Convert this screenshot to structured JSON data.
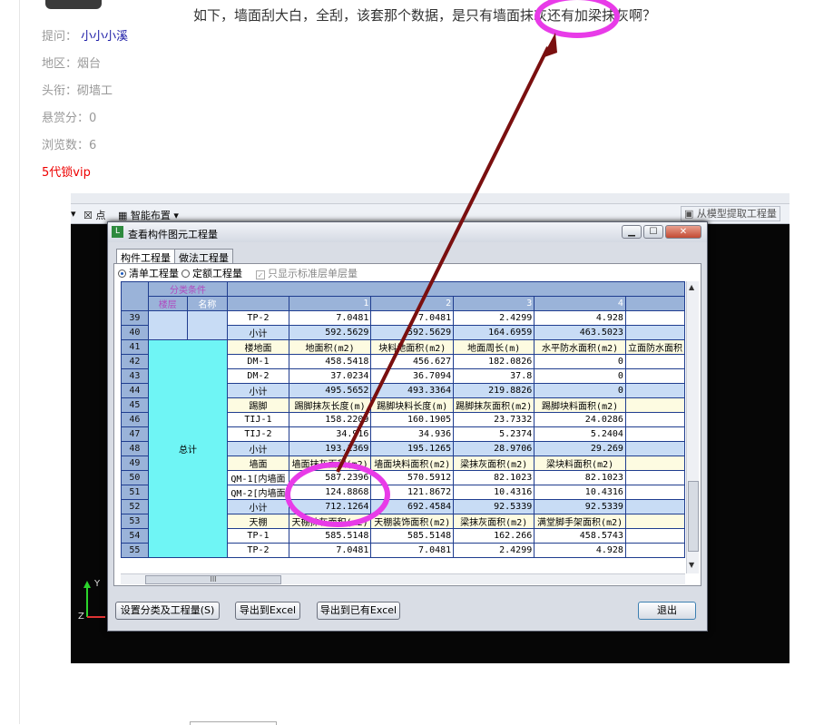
{
  "post": {
    "question": "如下，墙面刮大白，全刮，该套那个数据，是只有墙面抹灰还有加梁抹灰啊？",
    "asker_label": "提问：",
    "asker_name": "小小小溪",
    "region": "地区：烟台",
    "title_rank": "头衔：砌墙工",
    "reward": "悬赏分：0",
    "views": "浏览数：6",
    "vip_link": "5代锁vip"
  },
  "toolbar": {
    "point_label": "点",
    "smart_layout": "智能布置",
    "extract_label": "从模型提取工程量"
  },
  "dialog": {
    "title": "查看构件图元工程量",
    "min_glyph": "▁",
    "max_glyph": "☐",
    "close_glyph": "✕",
    "tabs": [
      "构件工程量",
      "做法工程量"
    ],
    "option_list": "清单工程量",
    "option_quota": "定额工程量",
    "option_std_floor": "只显示标准层单层量",
    "header": {
      "group": "分类条件",
      "floor": "楼层",
      "name": "名称",
      "cols": [
        "1",
        "2",
        "3",
        "4"
      ]
    },
    "total_label": "总计",
    "rows": [
      {
        "n": "39",
        "type": "data",
        "c0": "TP-2",
        "c1": "7.0481",
        "c2": "7.0481",
        "c3": "2.4299",
        "c4": "4.928",
        "c5": ""
      },
      {
        "n": "40",
        "type": "sub",
        "c0": "小计",
        "c1": "592.5629",
        "c2": "592.5629",
        "c3": "164.6959",
        "c4": "463.5023",
        "c5": ""
      },
      {
        "n": "41",
        "type": "yel",
        "c0": "楼地面",
        "c1": "地面积(m2)",
        "c2": "块料地面积(m2)",
        "c3": "地面周长(m)",
        "c4": "水平防水面积(m2)",
        "c5": "立面防水面积"
      },
      {
        "n": "42",
        "type": "data",
        "c0": "DM-1",
        "c1": "458.5418",
        "c2": "456.627",
        "c3": "182.0826",
        "c4": "0",
        "c5": ""
      },
      {
        "n": "43",
        "type": "data",
        "c0": "DM-2",
        "c1": "37.0234",
        "c2": "36.7094",
        "c3": "37.8",
        "c4": "0",
        "c5": ""
      },
      {
        "n": "44",
        "type": "sub",
        "c0": "小计",
        "c1": "495.5652",
        "c2": "493.3364",
        "c3": "219.8826",
        "c4": "0",
        "c5": ""
      },
      {
        "n": "45",
        "type": "yel",
        "c0": "踢脚",
        "c1": "踢脚抹灰长度(m)",
        "c2": "踢脚块料长度(m)",
        "c3": "踢脚抹灰面积(m2)",
        "c4": "踢脚块料面积(m2)",
        "c5": ""
      },
      {
        "n": "46",
        "type": "data",
        "c0": "TIJ-1",
        "c1": "158.2209",
        "c2": "160.1905",
        "c3": "23.7332",
        "c4": "24.0286",
        "c5": ""
      },
      {
        "n": "47",
        "type": "data",
        "c0": "TIJ-2",
        "c1": "34.916",
        "c2": "34.936",
        "c3": "5.2374",
        "c4": "5.2404",
        "c5": ""
      },
      {
        "n": "48",
        "type": "sub",
        "c0": "小计",
        "c1": "193.1369",
        "c2": "195.1265",
        "c3": "28.9706",
        "c4": "29.269",
        "c5": ""
      },
      {
        "n": "49",
        "type": "yel",
        "c0": "墙面",
        "c1": "墙面抹灰面积(m2)",
        "c2": "墙面块料面积(m2)",
        "c3": "梁抹灰面积(m2)",
        "c4": "梁块料面积(m2)",
        "c5": ""
      },
      {
        "n": "50",
        "type": "data",
        "c0": "QM-1[内墙面",
        "c1": "587.2396",
        "c2": "570.5912",
        "c3": "82.1023",
        "c4": "82.1023",
        "c5": ""
      },
      {
        "n": "51",
        "type": "data",
        "c0": "QM-2[内墙面",
        "c1": "124.8868",
        "c2": "121.8672",
        "c3": "10.4316",
        "c4": "10.4316",
        "c5": ""
      },
      {
        "n": "52",
        "type": "sub",
        "c0": "小计",
        "c1": "712.1264",
        "c2": "692.4584",
        "c3": "92.5339",
        "c4": "92.5339",
        "c5": ""
      },
      {
        "n": "53",
        "type": "yel",
        "c0": "天棚",
        "c1": "天棚抹灰面积(m2)",
        "c2": "天棚装饰面积(m2)",
        "c3": "梁抹灰面积(m2)",
        "c4": "满堂脚手架面积(m2)",
        "c5": ""
      },
      {
        "n": "54",
        "type": "data",
        "c0": "TP-1",
        "c1": "585.5148",
        "c2": "585.5148",
        "c3": "162.266",
        "c4": "458.5743",
        "c5": ""
      },
      {
        "n": "55",
        "type": "data",
        "c0": "TP-2",
        "c1": "7.0481",
        "c2": "7.0481",
        "c3": "2.4299",
        "c4": "4.928",
        "c5": ""
      }
    ],
    "hscroll_grip": "III",
    "buttons": {
      "settings": "设置分类及工程量(S)",
      "export_excel": "导出到Excel",
      "export_existing": "导出到已有Excel",
      "exit": "退出"
    }
  },
  "axes": {
    "y": "Y",
    "z": "Z"
  },
  "annotation_colors": {
    "ring": "#e83be8",
    "arrow": "#7a0f0f"
  }
}
